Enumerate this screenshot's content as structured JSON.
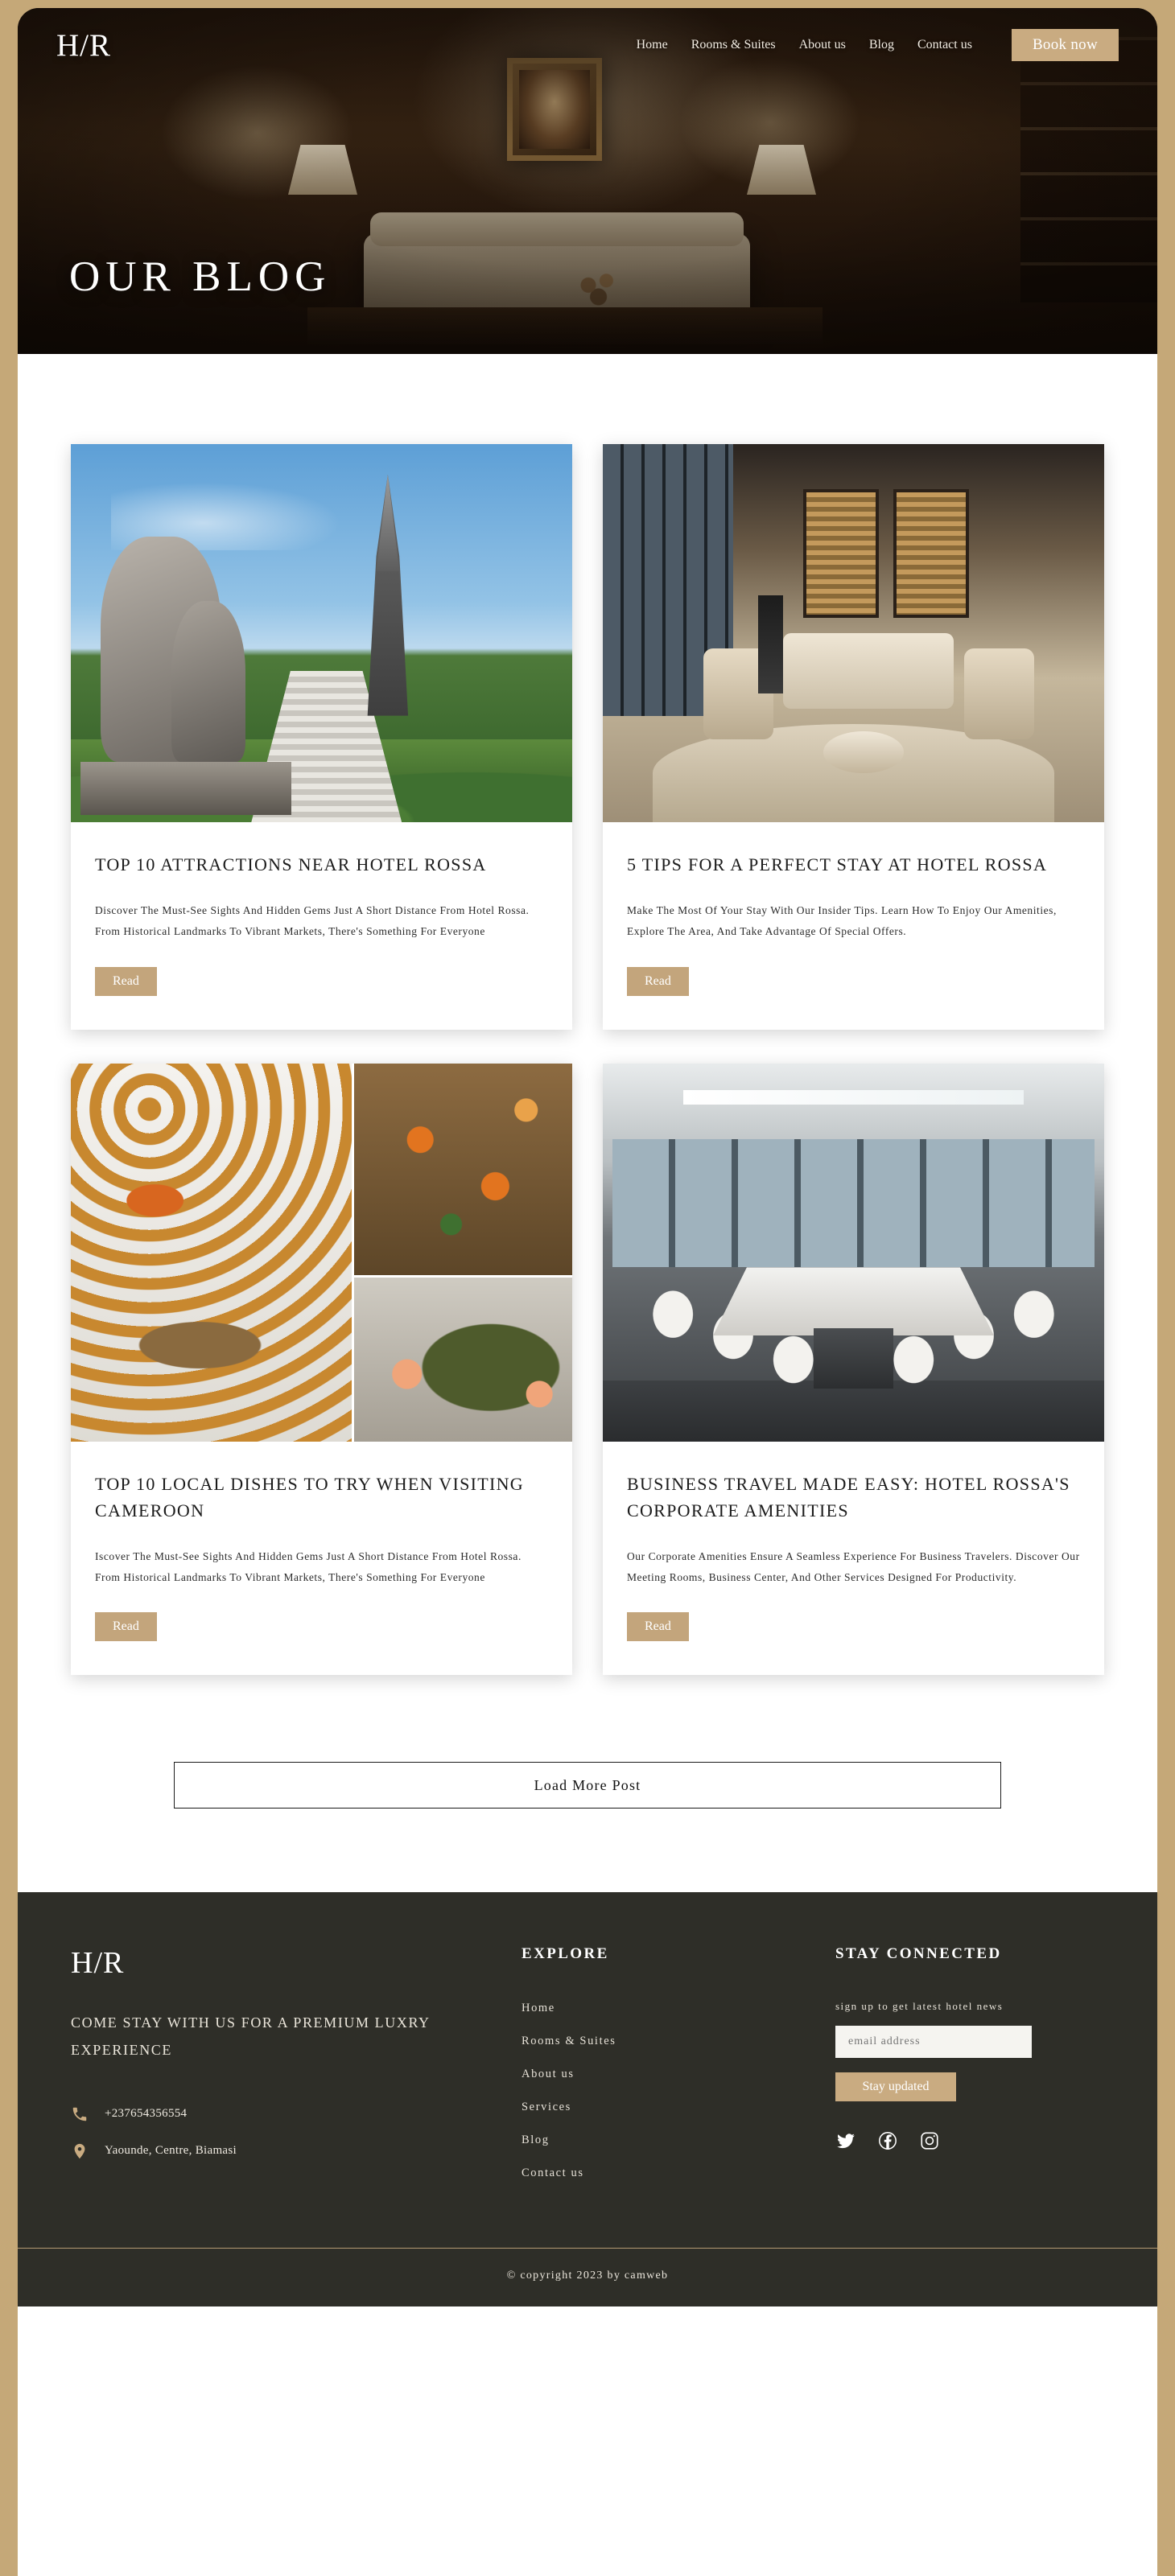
{
  "brand": {
    "logo": "H/R"
  },
  "nav": {
    "items": [
      {
        "label": "Home"
      },
      {
        "label": "Rooms & Suites"
      },
      {
        "label": "About us"
      },
      {
        "label": "Blog"
      },
      {
        "label": "Contact us"
      }
    ],
    "cta_label": "Book now"
  },
  "hero": {
    "title": "OUR BLOG"
  },
  "posts": [
    {
      "title": "TOP 10 ATTRACTIONS NEAR HOTEL ROSSA",
      "excerpt": "Discover The Must-See Sights And Hidden Gems Just A Short Distance From Hotel Rossa. From Historical Landmarks To Vibrant Markets, There's Something For Everyone",
      "button": "Read",
      "image_alt": "monument-and-statue-photo"
    },
    {
      "title": "5 TIPS FOR A PERFECT STAY AT HOTEL ROSSA",
      "excerpt": "Make The Most Of Your Stay With Our Insider Tips. Learn How To Enjoy Our Amenities, Explore The Area, And Take Advantage Of Special Offers.",
      "button": "Read",
      "image_alt": "hotel-lounge-interior-photo"
    },
    {
      "title": "TOP 10 LOCAL DISHES TO TRY WHEN VISITING CAMEROON",
      "excerpt": "Iscover The Must-See Sights And Hidden Gems Just A Short Distance From Hotel Rossa. From Historical Landmarks To Vibrant Markets, There's Something For Everyone",
      "button": "Read",
      "image_alt": "cameroonian-food-collage-photo"
    },
    {
      "title": "BUSINESS TRAVEL MADE EASY: HOTEL ROSSA'S CORPORATE AMENITIES",
      "excerpt": "Our Corporate Amenities Ensure A Seamless Experience For Business Travelers. Discover Our Meeting Rooms, Business Center, And Other Services Designed For Productivity.",
      "button": "Read",
      "image_alt": "boardroom-meeting-room-photo"
    }
  ],
  "load_more": {
    "label": "Load More Post"
  },
  "footer": {
    "logo": "H/R",
    "tagline": "COME STAY WITH US FOR A PREMIUM LUXRY EXPERIENCE",
    "phone": "+237654356554",
    "address": "Yaounde, Centre, Biamasi",
    "explore": {
      "heading": "EXPLORE",
      "links": [
        {
          "label": "Home"
        },
        {
          "label": "Rooms & Suites"
        },
        {
          "label": "About us"
        },
        {
          "label": "Services"
        },
        {
          "label": "Blog"
        },
        {
          "label": "Contact us"
        }
      ]
    },
    "stay": {
      "heading": "STAY CONNECTED",
      "subtitle": "sign up to get latest hotel news",
      "email_placeholder": "email address",
      "email_value": "",
      "button": "Stay updated",
      "socials": [
        {
          "name": "twitter"
        },
        {
          "name": "facebook"
        },
        {
          "name": "instagram"
        }
      ]
    },
    "copyright": "© copyright 2023 by camweb"
  },
  "colors": {
    "page_border": "#c5a878",
    "accent_gold": "#c9ab81",
    "footer_bg": "#2e2e28",
    "hero_dark": "#23150c"
  }
}
